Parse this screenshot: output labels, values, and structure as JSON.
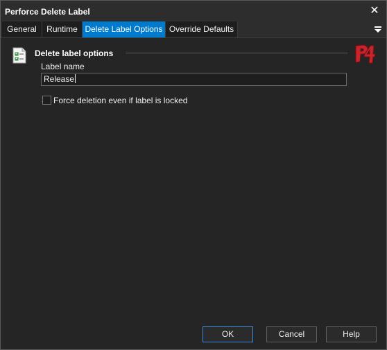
{
  "window": {
    "title": "Perforce Delete Label"
  },
  "tabs": [
    {
      "label": "General"
    },
    {
      "label": "Runtime"
    },
    {
      "label": "Delete Label Options",
      "active": true
    },
    {
      "label": "Override Defaults"
    }
  ],
  "icons": {
    "close": "close-icon",
    "tab_menu": "menu-icon",
    "section": "checklist-icon",
    "logo": "p4-logo"
  },
  "section": {
    "title": "Delete label options"
  },
  "fields": {
    "label_name": {
      "label": "Label name",
      "value": "Release"
    },
    "force_delete": {
      "label": "Force deletion even if label is locked",
      "checked": false
    }
  },
  "buttons": {
    "ok": "OK",
    "cancel": "Cancel",
    "help": "Help"
  },
  "colors": {
    "accent": "#007acc",
    "background": "#252525",
    "titlebar": "#2d2d2d",
    "logo_red": "#c8242b"
  }
}
